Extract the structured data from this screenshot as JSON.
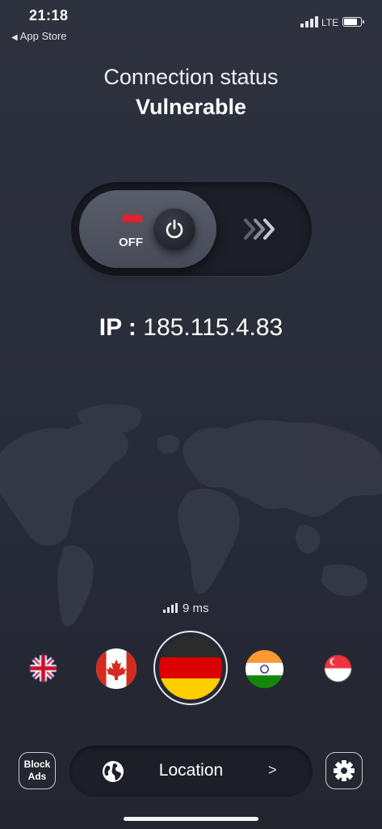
{
  "status_bar": {
    "time": "21:18",
    "back_label": "App Store",
    "network": "LTE"
  },
  "header": {
    "title": "Connection status",
    "status": "Vulnerable"
  },
  "toggle": {
    "state_label": "OFF",
    "indicator_color": "#e8202a"
  },
  "ip": {
    "label": "IP :",
    "value": "185.115.4.83"
  },
  "latency": {
    "value": "9 ms"
  },
  "locations": [
    {
      "country": "United Kingdom",
      "icon": "uk-flag-icon"
    },
    {
      "country": "Canada",
      "icon": "canada-flag-icon"
    },
    {
      "country": "Germany",
      "icon": "germany-flag-icon",
      "selected": true
    },
    {
      "country": "India",
      "icon": "india-flag-icon"
    },
    {
      "country": "Singapore",
      "icon": "singapore-flag-icon"
    }
  ],
  "bottom_bar": {
    "block_ads_line1": "Block",
    "block_ads_line2": "Ads",
    "location_label": "Location",
    "location_arrow": ">"
  },
  "colors": {
    "background": "#2a2d3a",
    "pill": "#1d1f28",
    "knob": "#51545f",
    "accent_off": "#e8202a"
  }
}
